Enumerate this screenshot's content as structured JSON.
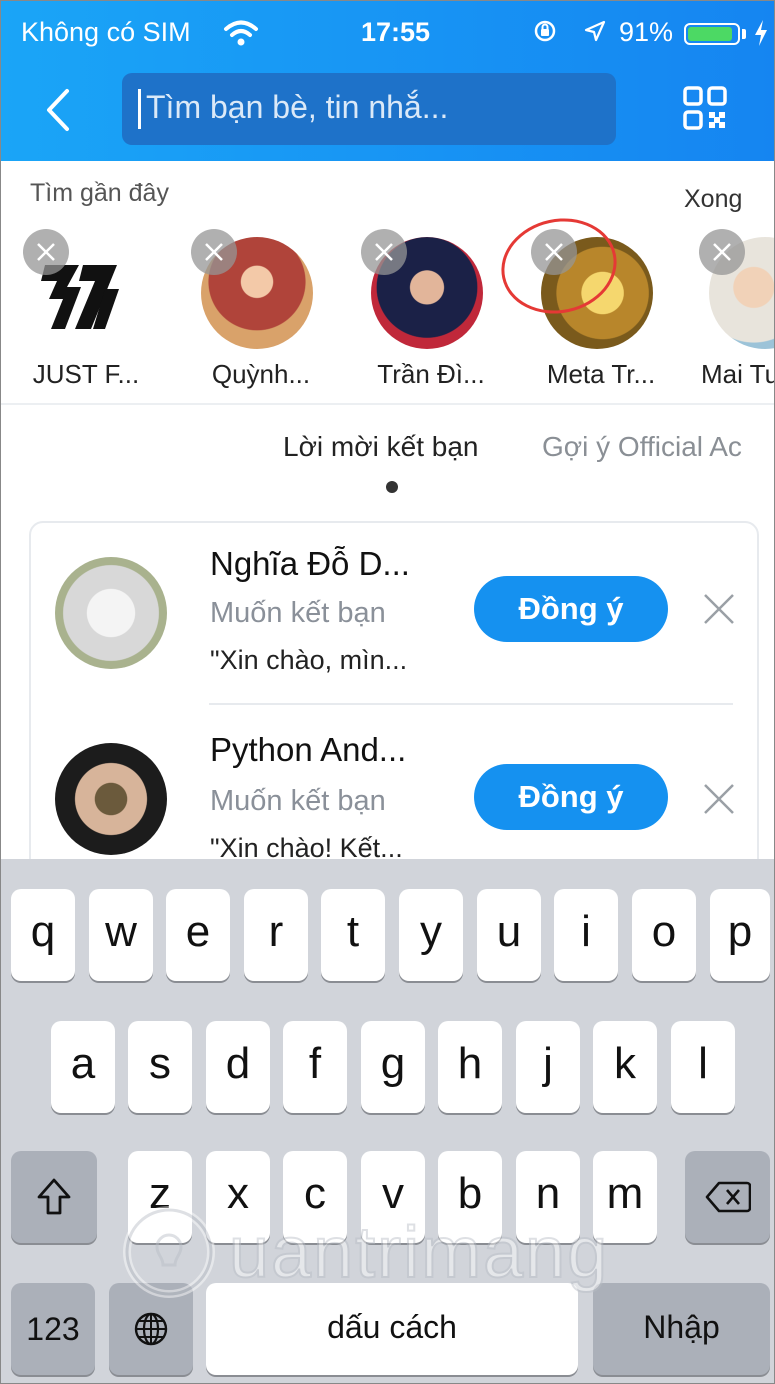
{
  "status_bar": {
    "carrier": "Không có SIM",
    "time": "17:55",
    "battery_text": "91%",
    "battery_level": 0.91
  },
  "header": {
    "search_placeholder": "Tìm bạn bè, tin nhắ..."
  },
  "recent": {
    "title": "Tìm gần đây",
    "done": "Xong",
    "items": [
      {
        "name": "JUST F..."
      },
      {
        "name": "Quỳnh..."
      },
      {
        "name": "Trần Đì..."
      },
      {
        "name": "Meta Tr..."
      },
      {
        "name": "Mai Tu"
      }
    ]
  },
  "tabs": {
    "friend_requests": "Lời mời kết bạn",
    "suggestions": "Gợi ý Official Ac"
  },
  "requests": [
    {
      "name": "Nghĩa Đỗ D...",
      "subtitle": "Muốn kết bạn",
      "message": "\"Xin chào, mìn...",
      "accept": "Đồng ý"
    },
    {
      "name": "Python And...",
      "subtitle": "Muốn kết bạn",
      "message": "\"Xin chào! Kết...",
      "accept": "Đồng ý"
    }
  ],
  "keyboard": {
    "row1": [
      "q",
      "w",
      "e",
      "r",
      "t",
      "y",
      "u",
      "i",
      "o",
      "p"
    ],
    "row2": [
      "a",
      "s",
      "d",
      "f",
      "g",
      "h",
      "j",
      "k",
      "l"
    ],
    "row3": [
      "z",
      "x",
      "c",
      "v",
      "b",
      "n",
      "m"
    ],
    "num_key": "123",
    "space": "dấu cách",
    "enter": "Nhập"
  },
  "watermark": "Quantrimang",
  "colors": {
    "header_start": "#1aa5f7",
    "header_end": "#1585f1",
    "accent": "#1591f0"
  }
}
